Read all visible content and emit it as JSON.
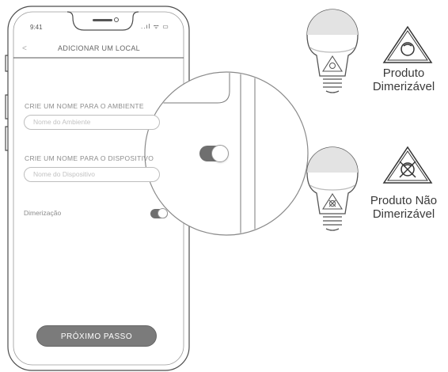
{
  "status_bar": {
    "time": "9:41",
    "icons": "..ıl ᯤ ▭"
  },
  "nav": {
    "back_icon": "chevron-left-icon",
    "back": "<",
    "title": "ADICIONAR UM LOCAL"
  },
  "form": {
    "environment_label": "CRIE UM NOME PARA O AMBIENTE",
    "environment_placeholder": "Nome do Ambiente",
    "device_label": "CRIE UM NOME PARA O DISPOSITIVO",
    "device_placeholder": "Nome do Dispositivo",
    "dimming_label": "Dimerização",
    "dimming_on": true
  },
  "next_button": "PRÓXIMO PASSO",
  "legend": {
    "dimmable": {
      "line1": "Produto",
      "line2": "Dimerizável",
      "icon": "dimmable-triangle-icon"
    },
    "non_dimmable": {
      "line1": "Produto Não",
      "line2": "Dimerizável",
      "icon": "non-dimmable-triangle-icon"
    }
  },
  "colors": {
    "outline": "#555555",
    "toggle": "#6f6f6f",
    "button": "#7b7b7b"
  }
}
